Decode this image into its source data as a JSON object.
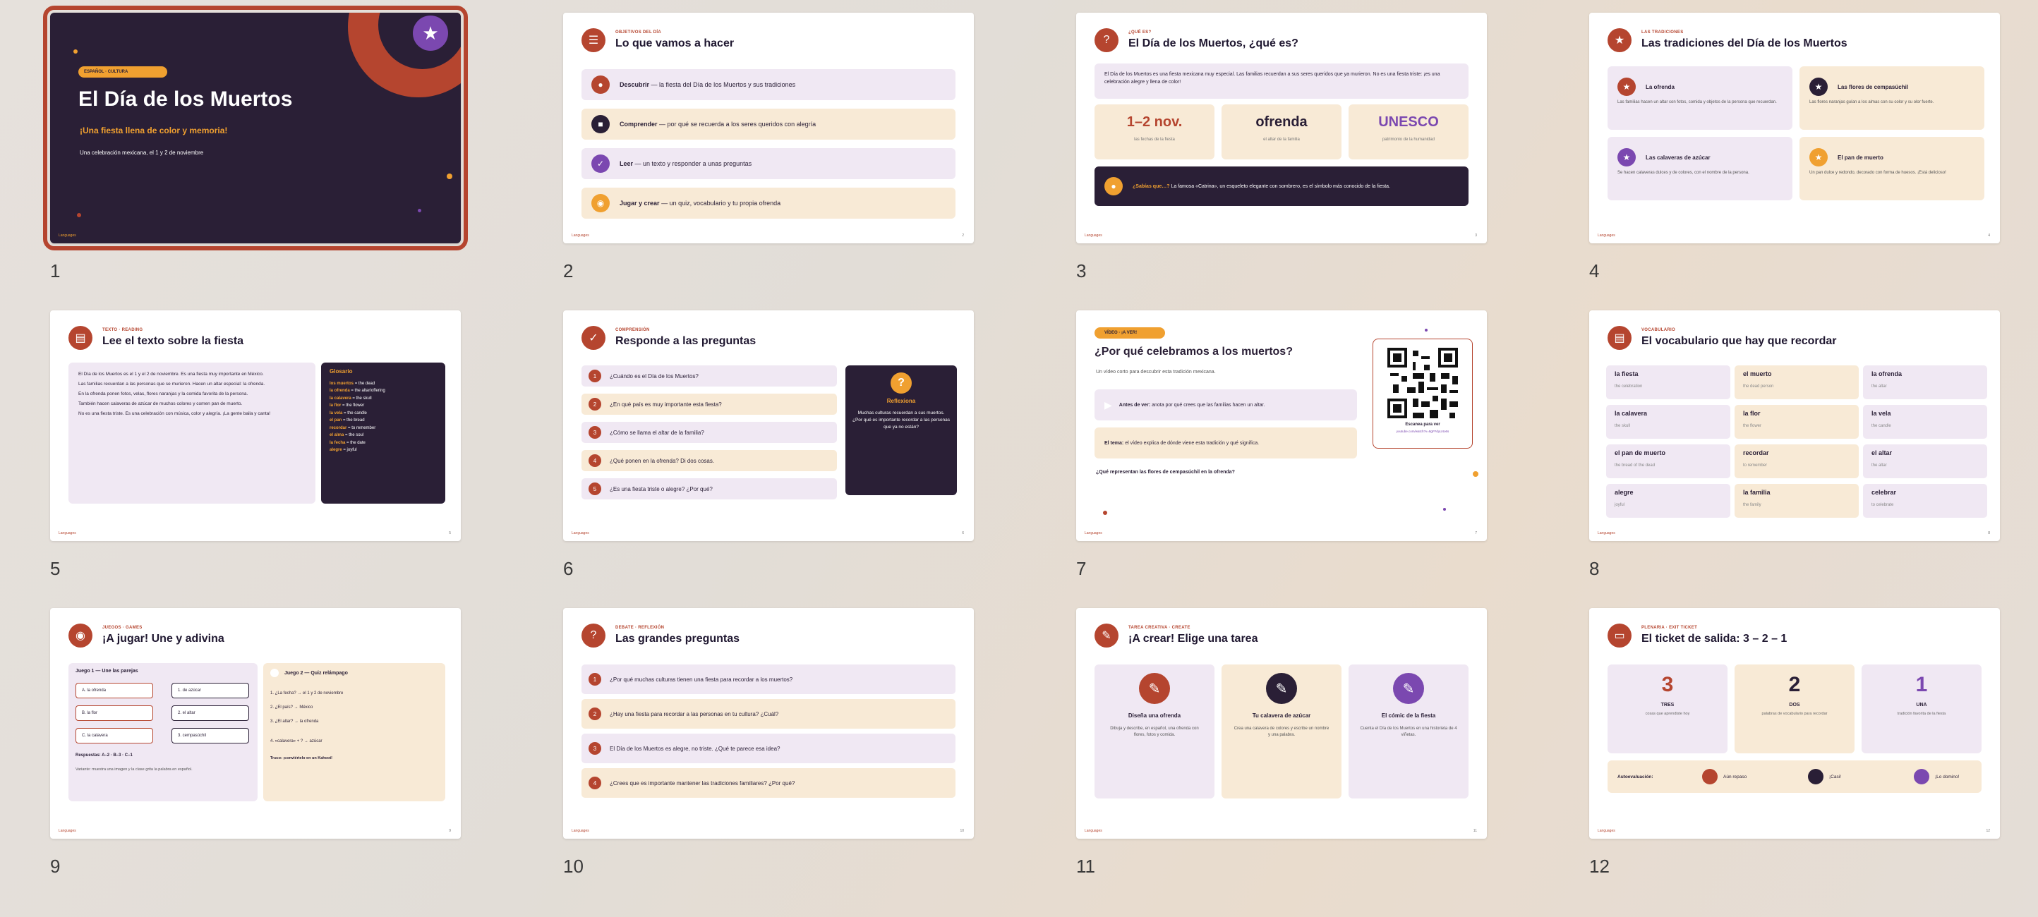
{
  "slides": [
    {
      "num": "1",
      "tag": "ESPAÑOL · CULTURA",
      "title": "El Día de los Muertos",
      "subtitle": "¡Una fiesta llena de color y memoria!",
      "desc": "Una celebración mexicana, el 1 y 2 de noviembre",
      "brand": "Languages"
    },
    {
      "num": "2",
      "kick": "OBJETIVOS DEL DÍA",
      "title": "Lo que vamos a hacer",
      "items": [
        {
          "b": "Descubrir",
          "t": "— la fiesta del Día de los Muertos y sus tradiciones"
        },
        {
          "b": "Comprender",
          "t": "— por qué se recuerda a los seres queridos con alegría"
        },
        {
          "b": "Leer",
          "t": "— un texto y responder a unas preguntas"
        },
        {
          "b": "Jugar y crear",
          "t": "— un quiz, vocabulario y tu propia ofrenda"
        }
      ],
      "page": "2"
    },
    {
      "num": "3",
      "kick": "¿QUÉ ES?",
      "title": "El Día de los Muertos, ¿qué es?",
      "intro": "El Día de los Muertos es una fiesta mexicana muy especial. Las familias recuerdan a sus seres queridos que ya murieron. No es una fiesta triste: ¡es una celebración alegre y llena de color!",
      "stats": [
        {
          "v": "1–2 nov.",
          "l": "las fechas de la fiesta"
        },
        {
          "v": "ofrenda",
          "l": "el altar de la familia"
        },
        {
          "v": "UNESCO",
          "l": "patrimonio de la humanidad"
        }
      ],
      "fact_b": "¿Sabías que…?",
      "fact": "La famosa «Catrina», un esqueleto elegante con sombrero, es el símbolo más conocido de la fiesta.",
      "page": "3"
    },
    {
      "num": "4",
      "kick": "LAS TRADICIONES",
      "title": "Las tradiciones del Día de los Muertos",
      "cards": [
        {
          "h": "La ofrenda",
          "t": "Las familias hacen un altar con fotos, comida y objetos de la persona que recuerdan."
        },
        {
          "h": "Las flores de cempasúchil",
          "t": "Las flores naranjas guían a los almas con su color y su olor fuerte."
        },
        {
          "h": "Las calaveras de azúcar",
          "t": "Se hacen calaveras dulces y de colores, con el nombre de la persona."
        },
        {
          "h": "El pan de muerto",
          "t": "Un pan dulce y redondo, decorado con forma de huesos. ¡Está delicioso!"
        }
      ],
      "page": "4"
    },
    {
      "num": "5",
      "kick": "TEXTO · READING",
      "title": "Lee el texto sobre la fiesta",
      "text": [
        "El Día de los Muertos es el 1 y el 2 de noviembre. Es una fiesta muy importante en México.",
        "Las familias recuerdan a las personas que se murieron. Hacen un altar especial: la ofrenda.",
        "En la ofrenda ponen fotos, velas, flores naranjas y la comida favorita de la persona.",
        "También hacen calaveras de azúcar de muchos colores y comen pan de muerto.",
        "No es una fiesta triste. Es una celebración con música, color y alegría. ¡La gente baila y canta!"
      ],
      "gloss_title": "Glosario",
      "gloss": [
        {
          "w": "los muertos",
          "t": "= the dead"
        },
        {
          "w": "la ofrenda",
          "t": "= the altar/offering"
        },
        {
          "w": "la calavera",
          "t": "= the skull"
        },
        {
          "w": "la flor",
          "t": "= the flower"
        },
        {
          "w": "la vela",
          "t": "= the candle"
        },
        {
          "w": "el pan",
          "t": "= the bread"
        },
        {
          "w": "recordar",
          "t": "= to remember"
        },
        {
          "w": "el alma",
          "t": "= the soul"
        },
        {
          "w": "la fecha",
          "t": "= the date"
        },
        {
          "w": "alegre",
          "t": "= joyful"
        }
      ],
      "page": "5"
    },
    {
      "num": "6",
      "kick": "COMPRENSIÓN",
      "title": "Responde a las preguntas",
      "qs": [
        "¿Cuándo es el Día de los Muertos?",
        "¿En qué país es muy importante esta fiesta?",
        "¿Cómo se llama el altar de la familia?",
        "¿Qué ponen en la ofrenda? Di dos cosas.",
        "¿Es una fiesta triste o alegre? ¿Por qué?"
      ],
      "reflect_h": "Reflexiona",
      "reflect": "Muchas culturas recuerdan a sus muertos. ¿Por qué es importante recordar a las personas que ya no están?",
      "page": "6"
    },
    {
      "num": "7",
      "tag": "VÍDEO · ¡A VER!",
      "title": "¿Por qué celebramos a los muertos?",
      "sub": "Un vídeo corto para descubrir esta tradición mexicana.",
      "before_b": "Antes de ver:",
      "before": "anota por qué crees que las familias hacen un altar.",
      "theme_b": "El tema:",
      "theme": "el vídeo explica de dónde viene esta tradición y qué significa.",
      "question": "¿Qué representan las flores de cempasúchil en la ofrenda?",
      "qr_label": "Escanea para ver",
      "qr_url": "youtube.com/watch?v=8gFFdyU4o6s",
      "page": "7"
    },
    {
      "num": "8",
      "kick": "VOCABULARIO",
      "title": "El vocabulario que hay que recordar",
      "vocab": [
        {
          "w": "la fiesta",
          "t": "the celebration"
        },
        {
          "w": "el muerto",
          "t": "the dead person"
        },
        {
          "w": "la ofrenda",
          "t": "the altar"
        },
        {
          "w": "la calavera",
          "t": "the skull"
        },
        {
          "w": "la flor",
          "t": "the flower"
        },
        {
          "w": "la vela",
          "t": "the candle"
        },
        {
          "w": "el pan de muerto",
          "t": "the bread of the dead"
        },
        {
          "w": "recordar",
          "t": "to remember"
        },
        {
          "w": "el altar",
          "t": "the altar"
        },
        {
          "w": "alegre",
          "t": "joyful"
        },
        {
          "w": "la familia",
          "t": "the family"
        },
        {
          "w": "celebrar",
          "t": "to celebrate"
        }
      ],
      "page": "8"
    },
    {
      "num": "9",
      "kick": "JUEGOS · GAMES",
      "title": "¡A jugar! Une y adivina",
      "g1": "Juego 1 — Une las parejas",
      "left": [
        "A. la ofrenda",
        "B. la flor",
        "C. la calavera"
      ],
      "right": [
        "1. de azúcar",
        "2. el altar",
        "3. cempasúchil"
      ],
      "answers": "Respuestas: A–2 · B–3 · C–1",
      "variant": "Variante: muestra una imagen y la clase grita la palabra en español.",
      "g2": "Juego 2 — Quiz relámpago",
      "quiz": [
        "1. ¿La fecha? → el 1 y 2 de noviembre",
        "2. ¿El país? → México",
        "3. ¿El altar? → la ofrenda",
        "4. «calavera» + ? → azúcar"
      ],
      "tip": "Truco: ¡conviértelo en un Kahoot!",
      "page": "9"
    },
    {
      "num": "10",
      "kick": "DEBATE · REFLEXIÓN",
      "title": "Las grandes preguntas",
      "qs": [
        "¿Por qué muchas culturas tienen una fiesta para recordar a los muertos?",
        "¿Hay una fiesta para recordar a las personas en tu cultura? ¿Cuál?",
        "El Día de los Muertos es alegre, no triste. ¿Qué te parece esa idea?",
        "¿Crees que es importante mantener las tradiciones familiares? ¿Por qué?"
      ],
      "page": "10"
    },
    {
      "num": "11",
      "kick": "TAREA CREATIVA · CREATE",
      "title": "¡A crear! Elige una tarea",
      "tasks": [
        {
          "h": "Diseña una ofrenda",
          "t": "Dibuja y describe, en español, una ofrenda con flores, fotos y comida."
        },
        {
          "h": "Tu calavera de azúcar",
          "t": "Crea una calavera de colores y escribe un nombre y una palabra."
        },
        {
          "h": "El cómic de la fiesta",
          "t": "Cuenta el Día de los Muertos en una historieta de 4 viñetas."
        }
      ],
      "page": "11"
    },
    {
      "num": "12",
      "kick": "PLENARIA · EXIT TICKET",
      "title": "El ticket de salida: 3 – 2 – 1",
      "tix": [
        {
          "n": "3",
          "w": "TRES",
          "t": "cosas que aprendiste hoy"
        },
        {
          "n": "2",
          "w": "DOS",
          "t": "palabras de vocabulario para recordar"
        },
        {
          "n": "1",
          "w": "UNA",
          "t": "tradición favorita de la fiesta"
        }
      ],
      "self": "Autoevaluación:",
      "levels": [
        "Aún repaso",
        "¡Casi!",
        "¡Lo domino!"
      ],
      "page": "12"
    }
  ],
  "colors": {
    "accent": "#b5452f",
    "dark": "#2a1f36",
    "orange": "#f0a030",
    "purple": "#7b48b0"
  }
}
